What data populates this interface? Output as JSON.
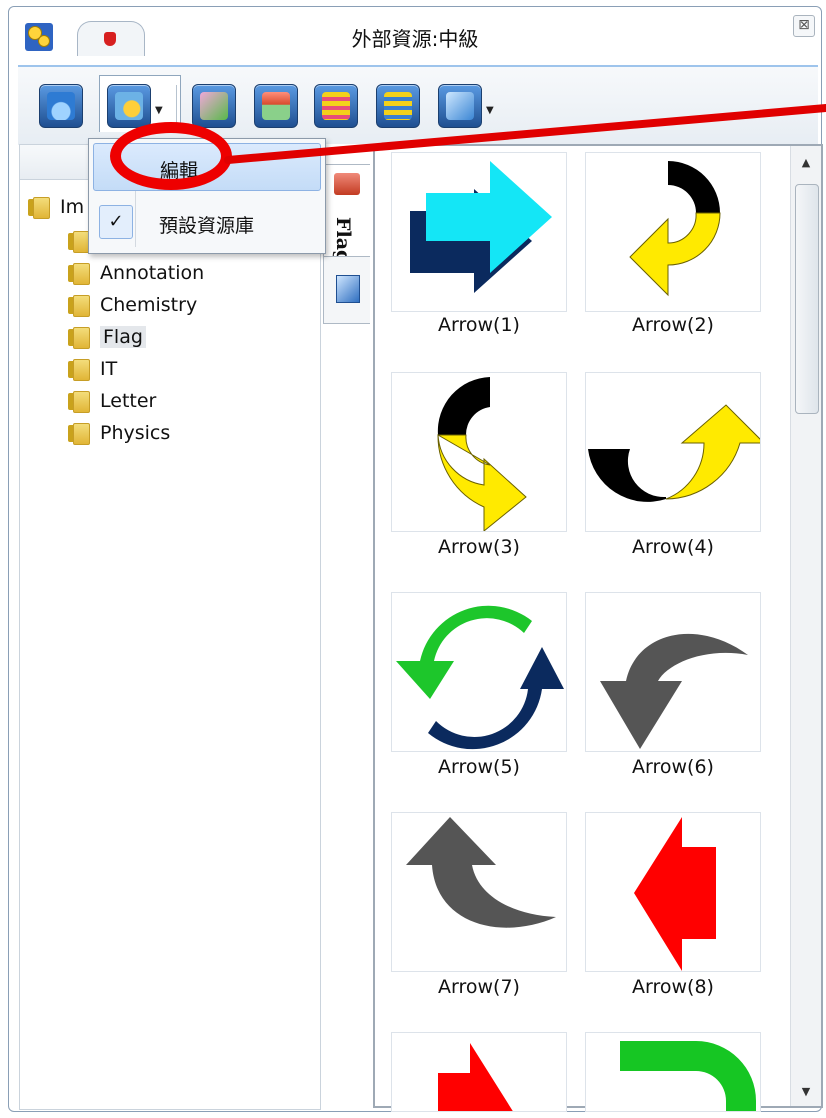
{
  "window": {
    "title": "外部資源:中級",
    "close_symbol": "⊠"
  },
  "toolbar": {
    "buttons": [
      {
        "name": "import-icon",
        "color": "#3b84d6"
      },
      {
        "name": "resource-settings-icon",
        "color": "#ffb300"
      },
      {
        "name": "refresh-icon",
        "color": "#39a640"
      },
      {
        "name": "folders-icon",
        "color": "#c84a2e"
      },
      {
        "name": "tree-list-icon",
        "color": "#f2d21b"
      },
      {
        "name": "tree-list-alt-icon",
        "color": "#f2d21b"
      },
      {
        "name": "gallery-icon",
        "color": "#5aa6e0"
      }
    ]
  },
  "menu": {
    "items": [
      {
        "label": "編輯",
        "checked": false,
        "highlighted": true
      },
      {
        "label": "預設資源庫",
        "checked": true,
        "check_symbol": "✓"
      }
    ]
  },
  "tree": {
    "root": "Im",
    "children": [
      "Annotation",
      "Chemistry",
      "Flag",
      "IT",
      "Letter",
      "Physics"
    ],
    "selected": "Flag"
  },
  "side_tabs": {
    "active_label": "Flag"
  },
  "gallery": {
    "items": [
      "Arrow(1)",
      "Arrow(2)",
      "Arrow(3)",
      "Arrow(4)",
      "Arrow(5)",
      "Arrow(6)",
      "Arrow(7)",
      "Arrow(8)"
    ]
  },
  "annotation": {
    "color": "#e00000"
  }
}
